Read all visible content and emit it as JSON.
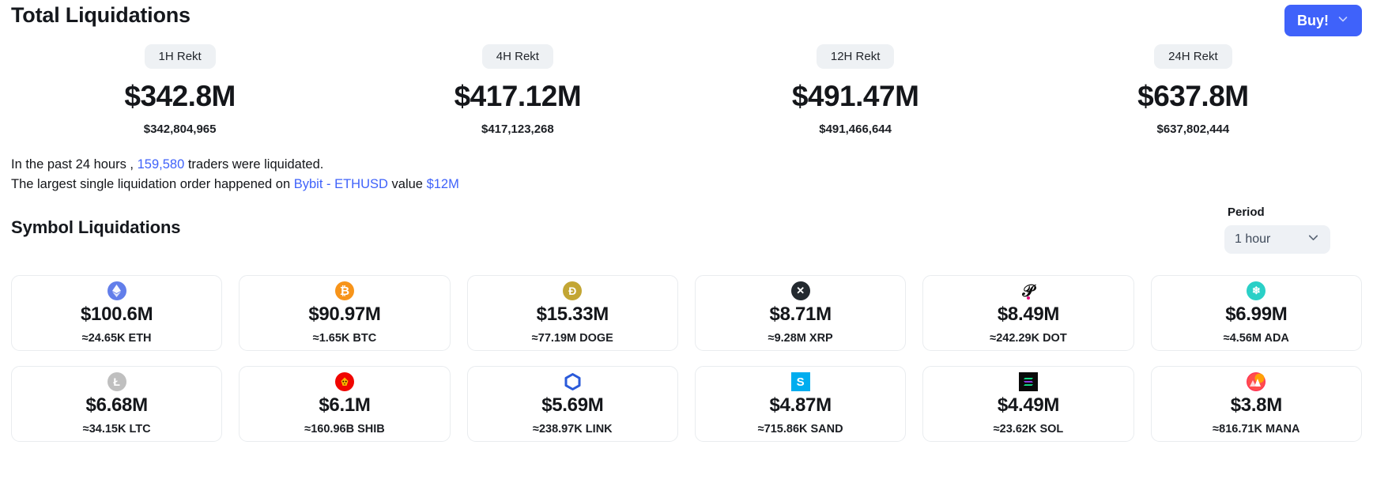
{
  "header": {
    "title": "Total Liquidations",
    "buy_button": {
      "label": "Buy!",
      "icon": "chevron-down-icon",
      "color": "#3f62fa"
    }
  },
  "totals": [
    {
      "period_label": "1H Rekt",
      "short_value": "$342.8M",
      "exact_value": "$342,804,965"
    },
    {
      "period_label": "4H Rekt",
      "short_value": "$417.12M",
      "exact_value": "$417,123,268"
    },
    {
      "period_label": "12H Rekt",
      "short_value": "$491.47M",
      "exact_value": "$491,466,644"
    },
    {
      "period_label": "24H Rekt",
      "short_value": "$637.8M",
      "exact_value": "$637,802,444"
    }
  ],
  "summary": {
    "line1_part1": "In the past 24 hours , ",
    "line1_traders": "159,580",
    "line1_part2": " traders were liquidated.",
    "line2_part1": "The largest single liquidation order happened on ",
    "line2_exchange": "Bybit - ETHUSD",
    "line2_part2": " value ",
    "line2_value": "$12M",
    "link_color": "#3f62fa"
  },
  "symbols_section": {
    "title": "Symbol Liquidations",
    "period_label": "Period",
    "period_value": "1 hour",
    "period_icon": "chevron-down-icon"
  },
  "symbol_cards": [
    {
      "icon": "eth-icon",
      "glyph": "◆",
      "value": "$100.6M",
      "amount": "≈24.65K ETH"
    },
    {
      "icon": "btc-icon",
      "glyph": "Ƀ",
      "value": "$90.97M",
      "amount": "≈1.65K BTC"
    },
    {
      "icon": "doge-icon",
      "glyph": "Ð",
      "value": "$15.33M",
      "amount": "≈77.19M DOGE"
    },
    {
      "icon": "xrp-icon",
      "glyph": "✕",
      "value": "$8.71M",
      "amount": "≈9.28M XRP"
    },
    {
      "icon": "dot-icon",
      "glyph": "P",
      "value": "$8.49M",
      "amount": "≈242.29K DOT"
    },
    {
      "icon": "ada-icon",
      "glyph": "✳",
      "value": "$6.99M",
      "amount": "≈4.56M ADA"
    },
    {
      "icon": "ltc-icon",
      "glyph": "Ł",
      "value": "$6.68M",
      "amount": "≈34.15K LTC"
    },
    {
      "icon": "shib-icon",
      "glyph": "●",
      "value": "$6.1M",
      "amount": "≈160.96B SHIB"
    },
    {
      "icon": "link-icon",
      "glyph": "⬡",
      "value": "$5.69M",
      "amount": "≈238.97K LINK"
    },
    {
      "icon": "sand-icon",
      "glyph": "S",
      "value": "$4.87M",
      "amount": "≈715.86K SAND"
    },
    {
      "icon": "sol-icon",
      "glyph": "≡",
      "value": "$4.49M",
      "amount": "≈23.62K SOL"
    },
    {
      "icon": "mana-icon",
      "glyph": "▲",
      "value": "$3.8M",
      "amount": "≈816.71K MANA"
    }
  ]
}
